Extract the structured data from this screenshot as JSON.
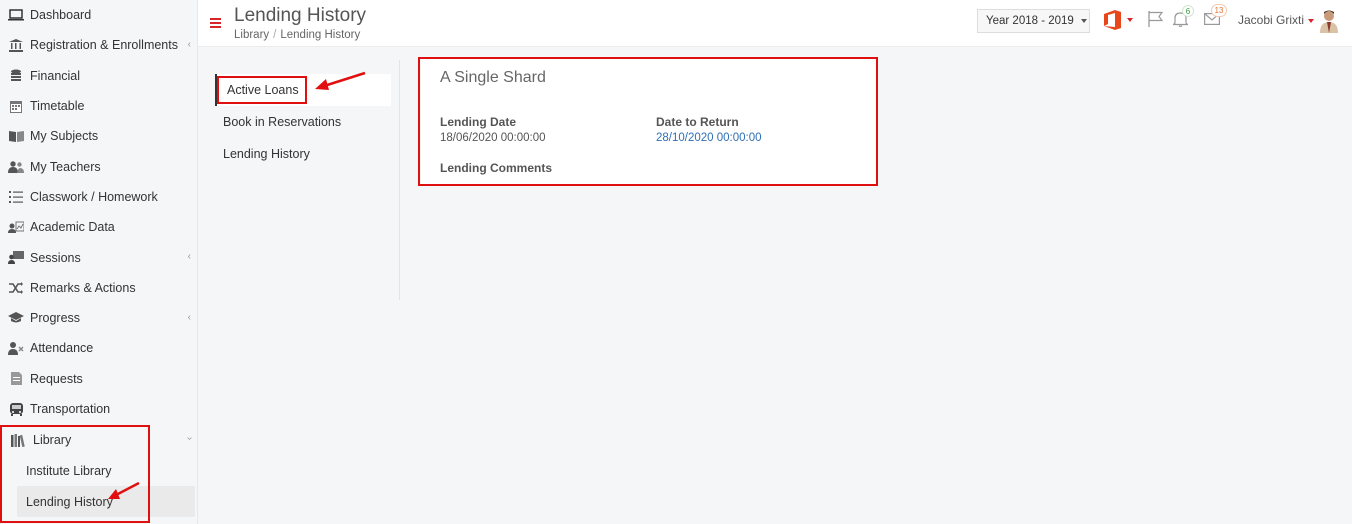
{
  "sidebar": {
    "items": [
      {
        "label": "Dashboard",
        "icon": "laptop-icon"
      },
      {
        "label": "Registration & Enrollments",
        "icon": "institution-icon"
      },
      {
        "label": "Financial",
        "icon": "coins-icon"
      },
      {
        "label": "Timetable",
        "icon": "calendar-icon"
      },
      {
        "label": "My Subjects",
        "icon": "book-icon"
      },
      {
        "label": "My Teachers",
        "icon": "users-icon"
      },
      {
        "label": "Classwork / Homework",
        "icon": "list-icon"
      },
      {
        "label": "Academic Data",
        "icon": "id-card-icon"
      },
      {
        "label": "Sessions",
        "icon": "presentation-icon"
      },
      {
        "label": "Remarks & Actions",
        "icon": "shuffle-icon"
      },
      {
        "label": "Progress",
        "icon": "graduation-cap-icon"
      },
      {
        "label": "Attendance",
        "icon": "user-x-icon"
      },
      {
        "label": "Requests",
        "icon": "file-icon"
      },
      {
        "label": "Transportation",
        "icon": "bus-icon"
      },
      {
        "label": "Library",
        "icon": "library-icon"
      }
    ],
    "library_sub": [
      "Institute Library",
      "Lending History"
    ]
  },
  "header": {
    "title": "Lending History",
    "breadcrumb": [
      "Library",
      "Lending History"
    ],
    "year": "Year 2018 - 2019",
    "notifications_count": "6",
    "messages_count": "13",
    "username": "Jacobi Grixti"
  },
  "library_nav": [
    "Active Loans",
    "Book in Reservations",
    "Lending History"
  ],
  "loan": {
    "title": "A Single Shard",
    "lending_date_label": "Lending Date",
    "lending_date": "18/06/2020 00:00:00",
    "return_date_label": "Date to Return",
    "return_date": "28/10/2020 00:00:00",
    "comments_label": "Lending Comments"
  },
  "colors": {
    "accent": "#d6262b",
    "link": "#2f6fb5",
    "annotation": "#e01010"
  }
}
